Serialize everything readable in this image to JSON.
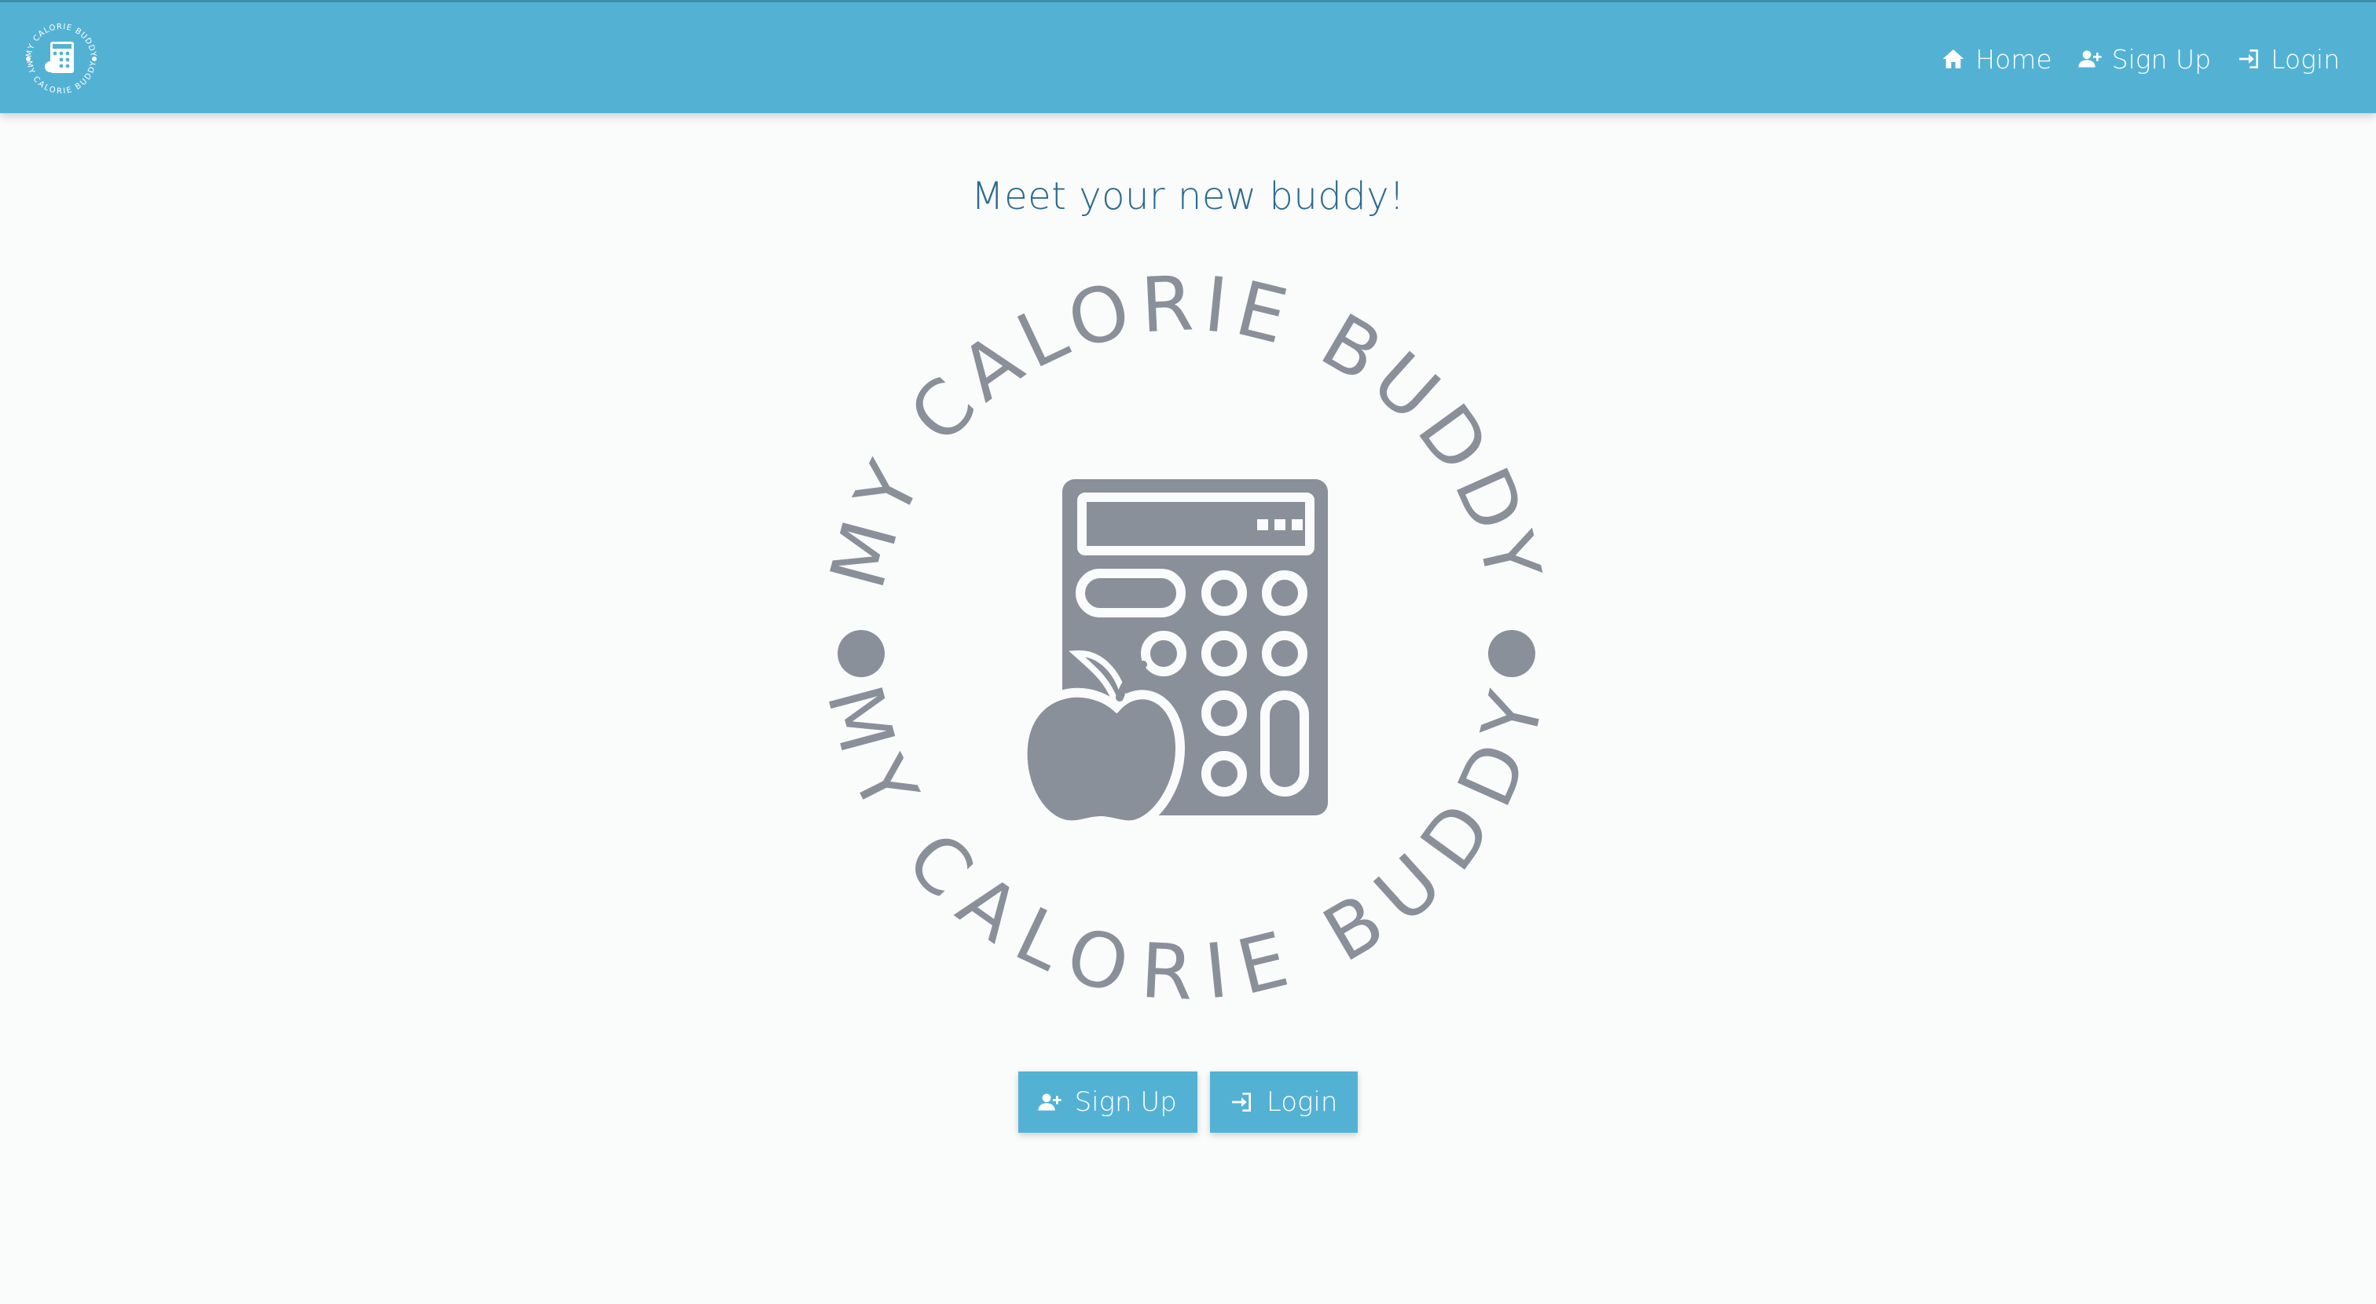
{
  "navbar": {
    "logo_text": "MY CALORIE BUDDY",
    "links": [
      {
        "label": "Home",
        "icon": "home-icon"
      },
      {
        "label": "Sign Up",
        "icon": "user-plus-icon"
      },
      {
        "label": "Login",
        "icon": "login-icon"
      }
    ]
  },
  "main": {
    "title": "Meet your new buddy!",
    "logo_text_top": "MY CALORIE BUDDY",
    "logo_text_bottom": "MY CALORIE BUDDY",
    "buttons": [
      {
        "label": "Sign Up",
        "icon": "user-plus-icon"
      },
      {
        "label": "Login",
        "icon": "login-icon"
      }
    ]
  },
  "colors": {
    "navbar_bg": "#53b2d4",
    "title": "#2a6b8e",
    "logo_gray": "#8a9099",
    "page_bg": "#fafbfb"
  }
}
